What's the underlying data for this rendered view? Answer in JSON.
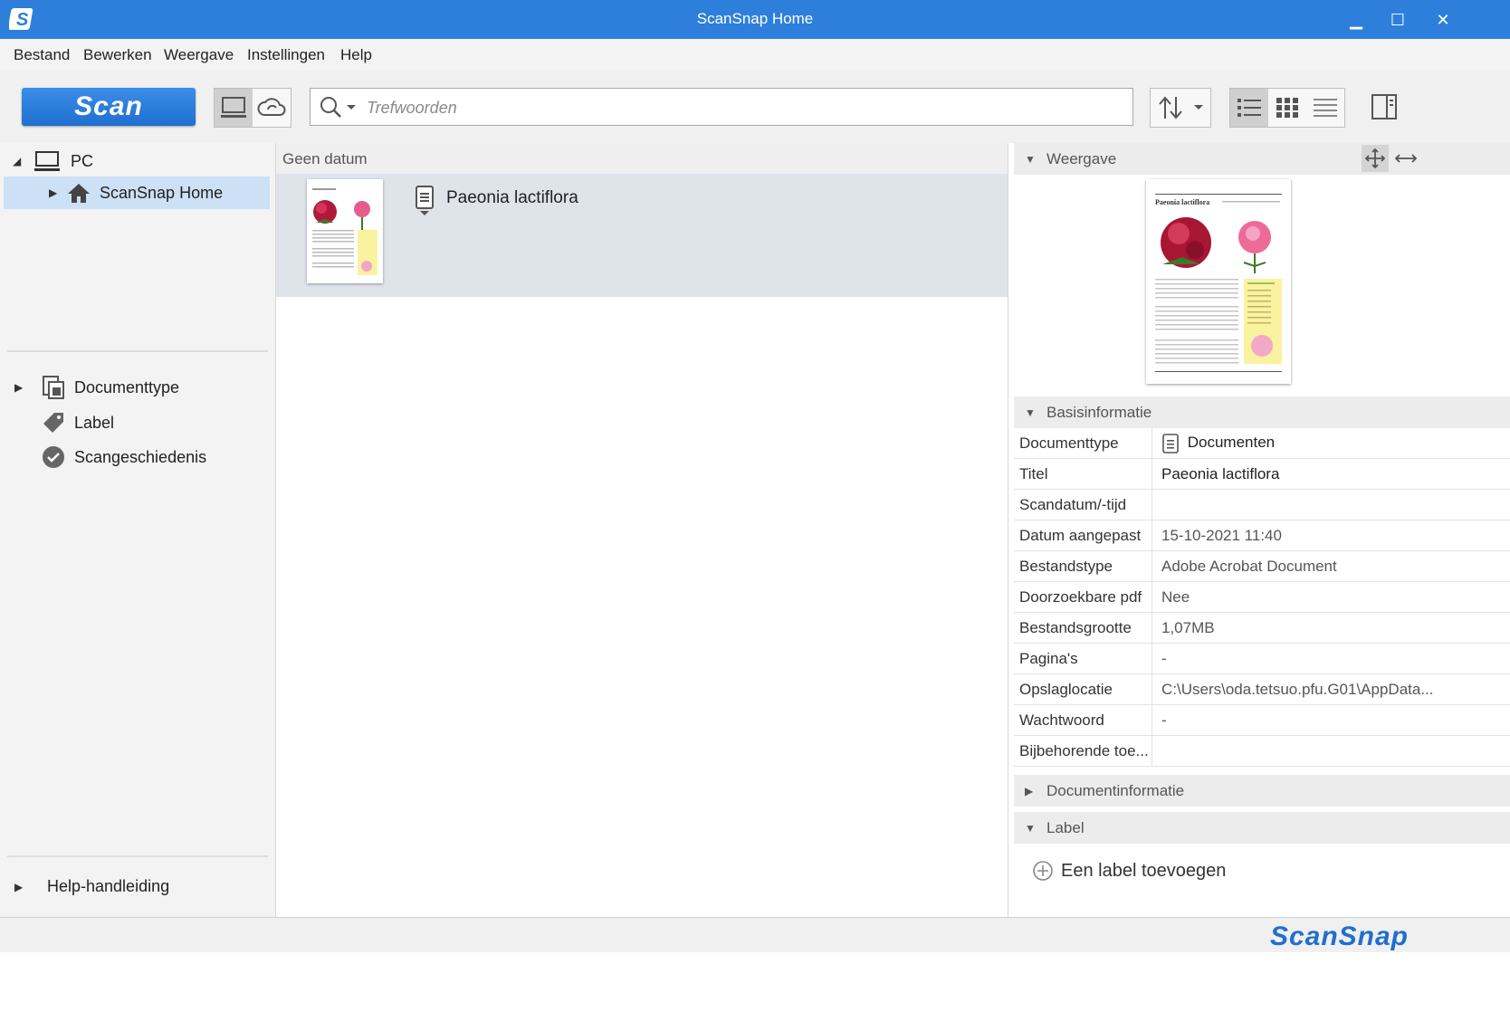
{
  "window": {
    "title": "ScanSnap Home",
    "minimize": "▁",
    "maximize": "☐",
    "close": "✕"
  },
  "menu": [
    "Bestand",
    "Bewerken",
    "Weergave",
    "Instellingen",
    "Help"
  ],
  "toolbar": {
    "scan_label": "Scan",
    "search_placeholder": "Trefwoorden"
  },
  "tree": {
    "pc": "PC",
    "scansnap_home": "ScanSnap Home",
    "documenttype": "Documenttype",
    "label": "Label",
    "scan_history": "Scangeschiedenis",
    "help_manual": "Help-handleiding"
  },
  "list": {
    "group_header": "Geen datum",
    "items": [
      {
        "title": "Paeonia lactiflora"
      }
    ]
  },
  "preview": {
    "header": "Weergave",
    "page_title": "Paeonia lactiflora"
  },
  "basic_info": {
    "header": "Basisinformatie",
    "rows": [
      {
        "key": "Documenttype",
        "value": "Documenten"
      },
      {
        "key": "Titel",
        "value": "Paeonia lactiflora"
      },
      {
        "key": "Scandatum/-tijd",
        "value": ""
      },
      {
        "key": "Datum aangepast",
        "value": "15-10-2021 11:40"
      },
      {
        "key": "Bestandstype",
        "value": "Adobe Acrobat Document"
      },
      {
        "key": "Doorzoekbare pdf",
        "value": "Nee"
      },
      {
        "key": "Bestandsgrootte",
        "value": "1,07MB"
      },
      {
        "key": "Pagina's",
        "value": "-"
      },
      {
        "key": "Opslaglocatie",
        "value": "C:\\Users\\oda.tetsuo.pfu.G01\\AppData..."
      },
      {
        "key": "Wachtwoord",
        "value": "-"
      },
      {
        "key": "Bijbehorende toe...",
        "value": ""
      }
    ]
  },
  "doc_info": {
    "header": "Documentinformatie"
  },
  "label_section": {
    "header": "Label",
    "add_label": "Een label toevoegen"
  },
  "brand": {
    "logo_text": "ScanSnap"
  },
  "colors": {
    "accent": "#2d7fdb",
    "selection": "#cce0f6"
  }
}
